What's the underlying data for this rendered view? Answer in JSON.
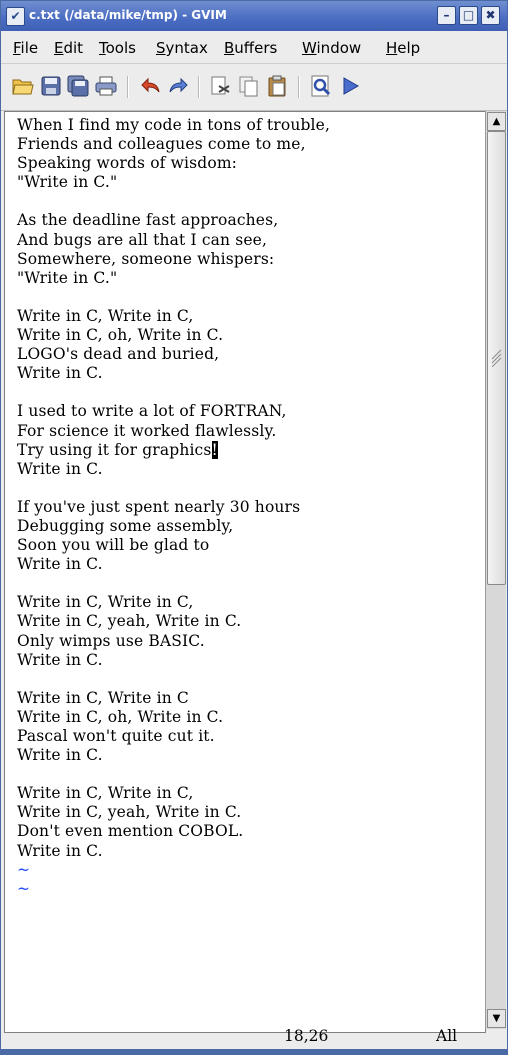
{
  "window": {
    "title": "c.txt (/data/mike/tmp) - GVIM",
    "buttons": {
      "minimize": "–",
      "maximize": "□",
      "close": "✖"
    }
  },
  "menu": [
    "File",
    "Edit",
    "Tools",
    "Syntax",
    "Buffers",
    "Window",
    "Help"
  ],
  "toolbar": [
    "open-icon",
    "save-icon",
    "save-all-icon",
    "print-icon",
    "undo-icon",
    "redo-icon",
    "cut-icon",
    "copy-icon",
    "paste-icon",
    "find-icon",
    "run-icon"
  ],
  "editor": {
    "lines": [
      "When I find my code in tons of trouble,",
      "Friends and colleagues come to me,",
      "Speaking words of wisdom:",
      "\"Write in C.\"",
      "",
      "As the deadline fast approaches,",
      "And bugs are all that I can see,",
      "Somewhere, someone whispers:",
      "\"Write in C.\"",
      "",
      "Write in C, Write in C,",
      "Write in C, oh, Write in C.",
      "LOGO's dead and buried,",
      "Write in C.",
      "",
      "I used to write a lot of FORTRAN,",
      "For science it worked flawlessly.",
      "Try using it for graphics",
      "Write in C.",
      "",
      "If you've just spent nearly 30 hours",
      "Debugging some assembly,",
      "Soon you will be glad to",
      "Write in C.",
      "",
      "Write in C, Write in C,",
      "Write in C, yeah, Write in C.",
      "Only wimps use BASIC.",
      "Write in C.",
      "",
      "Write in C, Write in C",
      "Write in C, oh, Write in C.",
      "Pascal won't quite cut it.",
      "Write in C.",
      "",
      "Write in C, Write in C,",
      "Write in C, yeah, Write in C.",
      "Don't even mention COBOL.",
      "Write in C."
    ],
    "cursor_char": "!",
    "tilde": "~",
    "ruler": {
      "position": "18,26",
      "scroll": "All"
    }
  },
  "colors": {
    "titlebar": "#4a6cc2",
    "tilde": "#1a44ff"
  }
}
